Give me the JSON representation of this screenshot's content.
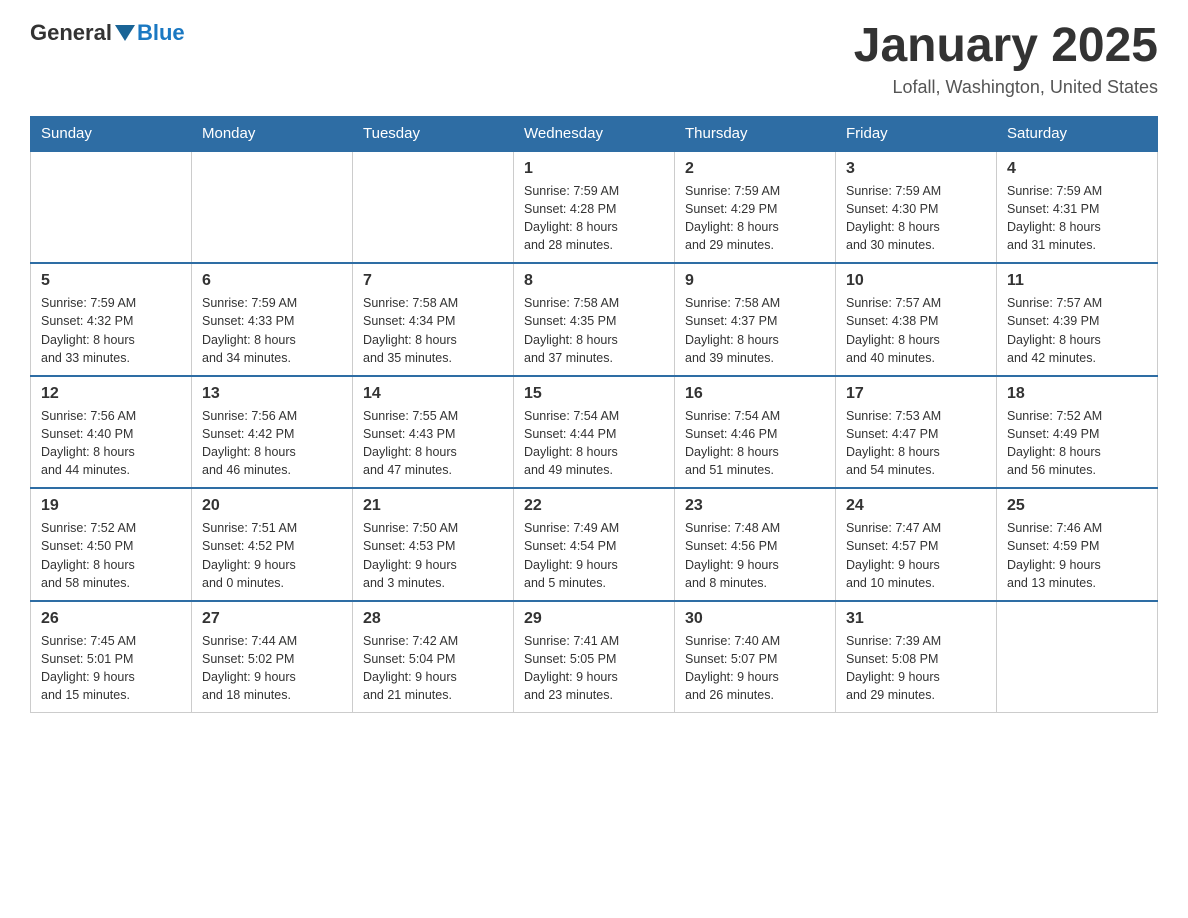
{
  "logo": {
    "general": "General",
    "blue": "Blue"
  },
  "header": {
    "month": "January 2025",
    "location": "Lofall, Washington, United States"
  },
  "weekdays": [
    "Sunday",
    "Monday",
    "Tuesday",
    "Wednesday",
    "Thursday",
    "Friday",
    "Saturday"
  ],
  "weeks": [
    [
      {
        "day": "",
        "info": ""
      },
      {
        "day": "",
        "info": ""
      },
      {
        "day": "",
        "info": ""
      },
      {
        "day": "1",
        "info": "Sunrise: 7:59 AM\nSunset: 4:28 PM\nDaylight: 8 hours\nand 28 minutes."
      },
      {
        "day": "2",
        "info": "Sunrise: 7:59 AM\nSunset: 4:29 PM\nDaylight: 8 hours\nand 29 minutes."
      },
      {
        "day": "3",
        "info": "Sunrise: 7:59 AM\nSunset: 4:30 PM\nDaylight: 8 hours\nand 30 minutes."
      },
      {
        "day": "4",
        "info": "Sunrise: 7:59 AM\nSunset: 4:31 PM\nDaylight: 8 hours\nand 31 minutes."
      }
    ],
    [
      {
        "day": "5",
        "info": "Sunrise: 7:59 AM\nSunset: 4:32 PM\nDaylight: 8 hours\nand 33 minutes."
      },
      {
        "day": "6",
        "info": "Sunrise: 7:59 AM\nSunset: 4:33 PM\nDaylight: 8 hours\nand 34 minutes."
      },
      {
        "day": "7",
        "info": "Sunrise: 7:58 AM\nSunset: 4:34 PM\nDaylight: 8 hours\nand 35 minutes."
      },
      {
        "day": "8",
        "info": "Sunrise: 7:58 AM\nSunset: 4:35 PM\nDaylight: 8 hours\nand 37 minutes."
      },
      {
        "day": "9",
        "info": "Sunrise: 7:58 AM\nSunset: 4:37 PM\nDaylight: 8 hours\nand 39 minutes."
      },
      {
        "day": "10",
        "info": "Sunrise: 7:57 AM\nSunset: 4:38 PM\nDaylight: 8 hours\nand 40 minutes."
      },
      {
        "day": "11",
        "info": "Sunrise: 7:57 AM\nSunset: 4:39 PM\nDaylight: 8 hours\nand 42 minutes."
      }
    ],
    [
      {
        "day": "12",
        "info": "Sunrise: 7:56 AM\nSunset: 4:40 PM\nDaylight: 8 hours\nand 44 minutes."
      },
      {
        "day": "13",
        "info": "Sunrise: 7:56 AM\nSunset: 4:42 PM\nDaylight: 8 hours\nand 46 minutes."
      },
      {
        "day": "14",
        "info": "Sunrise: 7:55 AM\nSunset: 4:43 PM\nDaylight: 8 hours\nand 47 minutes."
      },
      {
        "day": "15",
        "info": "Sunrise: 7:54 AM\nSunset: 4:44 PM\nDaylight: 8 hours\nand 49 minutes."
      },
      {
        "day": "16",
        "info": "Sunrise: 7:54 AM\nSunset: 4:46 PM\nDaylight: 8 hours\nand 51 minutes."
      },
      {
        "day": "17",
        "info": "Sunrise: 7:53 AM\nSunset: 4:47 PM\nDaylight: 8 hours\nand 54 minutes."
      },
      {
        "day": "18",
        "info": "Sunrise: 7:52 AM\nSunset: 4:49 PM\nDaylight: 8 hours\nand 56 minutes."
      }
    ],
    [
      {
        "day": "19",
        "info": "Sunrise: 7:52 AM\nSunset: 4:50 PM\nDaylight: 8 hours\nand 58 minutes."
      },
      {
        "day": "20",
        "info": "Sunrise: 7:51 AM\nSunset: 4:52 PM\nDaylight: 9 hours\nand 0 minutes."
      },
      {
        "day": "21",
        "info": "Sunrise: 7:50 AM\nSunset: 4:53 PM\nDaylight: 9 hours\nand 3 minutes."
      },
      {
        "day": "22",
        "info": "Sunrise: 7:49 AM\nSunset: 4:54 PM\nDaylight: 9 hours\nand 5 minutes."
      },
      {
        "day": "23",
        "info": "Sunrise: 7:48 AM\nSunset: 4:56 PM\nDaylight: 9 hours\nand 8 minutes."
      },
      {
        "day": "24",
        "info": "Sunrise: 7:47 AM\nSunset: 4:57 PM\nDaylight: 9 hours\nand 10 minutes."
      },
      {
        "day": "25",
        "info": "Sunrise: 7:46 AM\nSunset: 4:59 PM\nDaylight: 9 hours\nand 13 minutes."
      }
    ],
    [
      {
        "day": "26",
        "info": "Sunrise: 7:45 AM\nSunset: 5:01 PM\nDaylight: 9 hours\nand 15 minutes."
      },
      {
        "day": "27",
        "info": "Sunrise: 7:44 AM\nSunset: 5:02 PM\nDaylight: 9 hours\nand 18 minutes."
      },
      {
        "day": "28",
        "info": "Sunrise: 7:42 AM\nSunset: 5:04 PM\nDaylight: 9 hours\nand 21 minutes."
      },
      {
        "day": "29",
        "info": "Sunrise: 7:41 AM\nSunset: 5:05 PM\nDaylight: 9 hours\nand 23 minutes."
      },
      {
        "day": "30",
        "info": "Sunrise: 7:40 AM\nSunset: 5:07 PM\nDaylight: 9 hours\nand 26 minutes."
      },
      {
        "day": "31",
        "info": "Sunrise: 7:39 AM\nSunset: 5:08 PM\nDaylight: 9 hours\nand 29 minutes."
      },
      {
        "day": "",
        "info": ""
      }
    ]
  ]
}
